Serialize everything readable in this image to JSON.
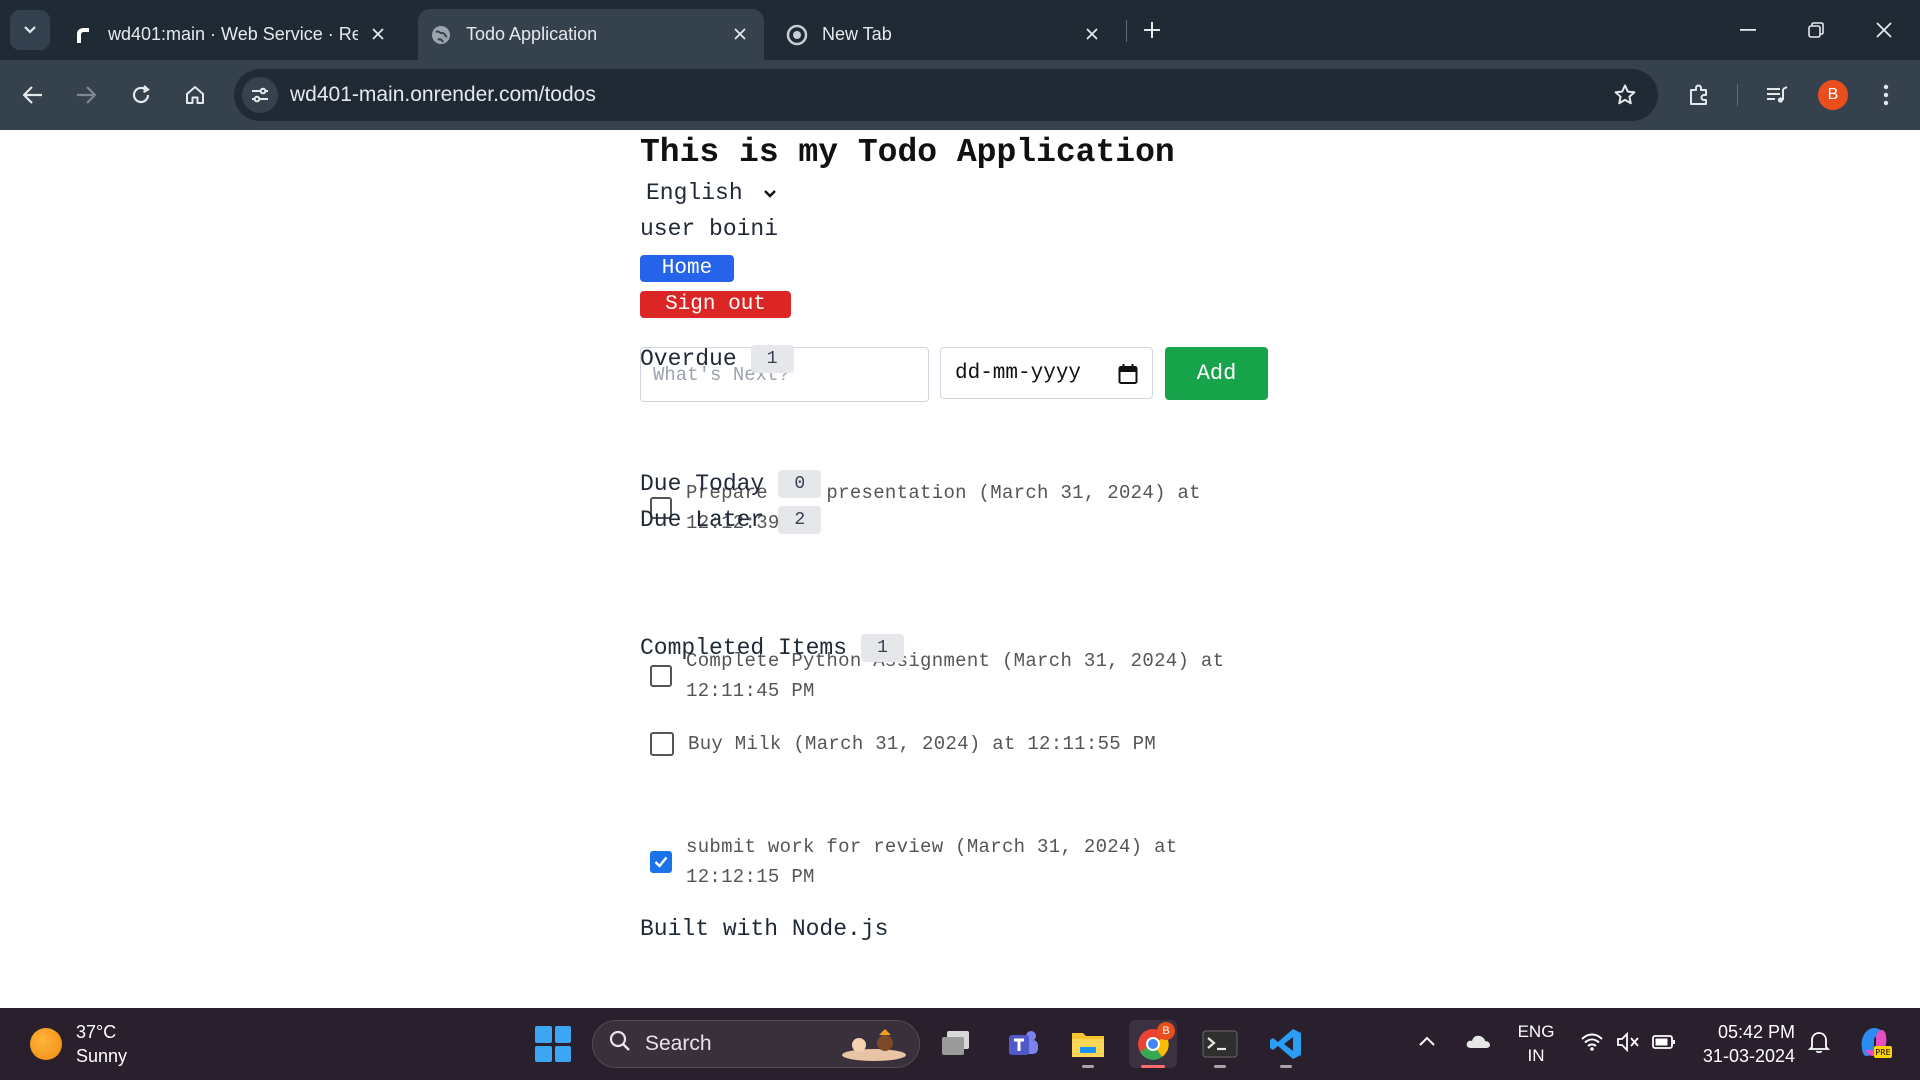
{
  "browser": {
    "tabs": [
      {
        "title": "wd401:main · Web Service · Re"
      },
      {
        "title": "Todo Application"
      },
      {
        "title": "New Tab"
      }
    ],
    "url": "wd401-main.onrender.com/todos",
    "profile_initial": "B"
  },
  "page": {
    "title": "This is my Todo Application",
    "language": "English",
    "user_text": "user boini",
    "home_label": "Home",
    "signout_label": "Sign out",
    "todo_placeholder": "What's Next?",
    "date_placeholder": "dd-mm-yyyy",
    "add_label": "Add",
    "sections": {
      "overdue": {
        "title": "Overdue",
        "count": "1",
        "items": [
          {
            "line1": "Prepare for presentation (March 31, 2024) at",
            "line2": "12:12:39 PM",
            "completed": false
          }
        ]
      },
      "due_today": {
        "title": "Due Today",
        "count": "0"
      },
      "due_later": {
        "title": "Due Later",
        "count": "2",
        "items": [
          {
            "line1": "Complete Python Assignment (March 31, 2024) at",
            "line2": "12:11:45 PM",
            "completed": false
          },
          {
            "line1": "Buy Milk (March 31, 2024) at 12:11:55 PM",
            "completed": false
          }
        ]
      },
      "completed": {
        "title": "Completed Items",
        "count": "1",
        "items": [
          {
            "line1": "submit work for review (March 31, 2024) at",
            "line2": "12:12:15 PM",
            "completed": true
          }
        ]
      }
    },
    "footer": "Built with Node.js"
  },
  "taskbar": {
    "weather_temp": "37°C",
    "weather_desc": "Sunny",
    "search_label": "Search",
    "lang_top": "ENG",
    "lang_bottom": "IN",
    "time": "05:42 PM",
    "date": "31-03-2024"
  },
  "colors": {
    "home_button": "#2563eb",
    "signout_button": "#dc2626",
    "add_button": "#16a34a",
    "chrome_toolbar": "#35414d"
  }
}
